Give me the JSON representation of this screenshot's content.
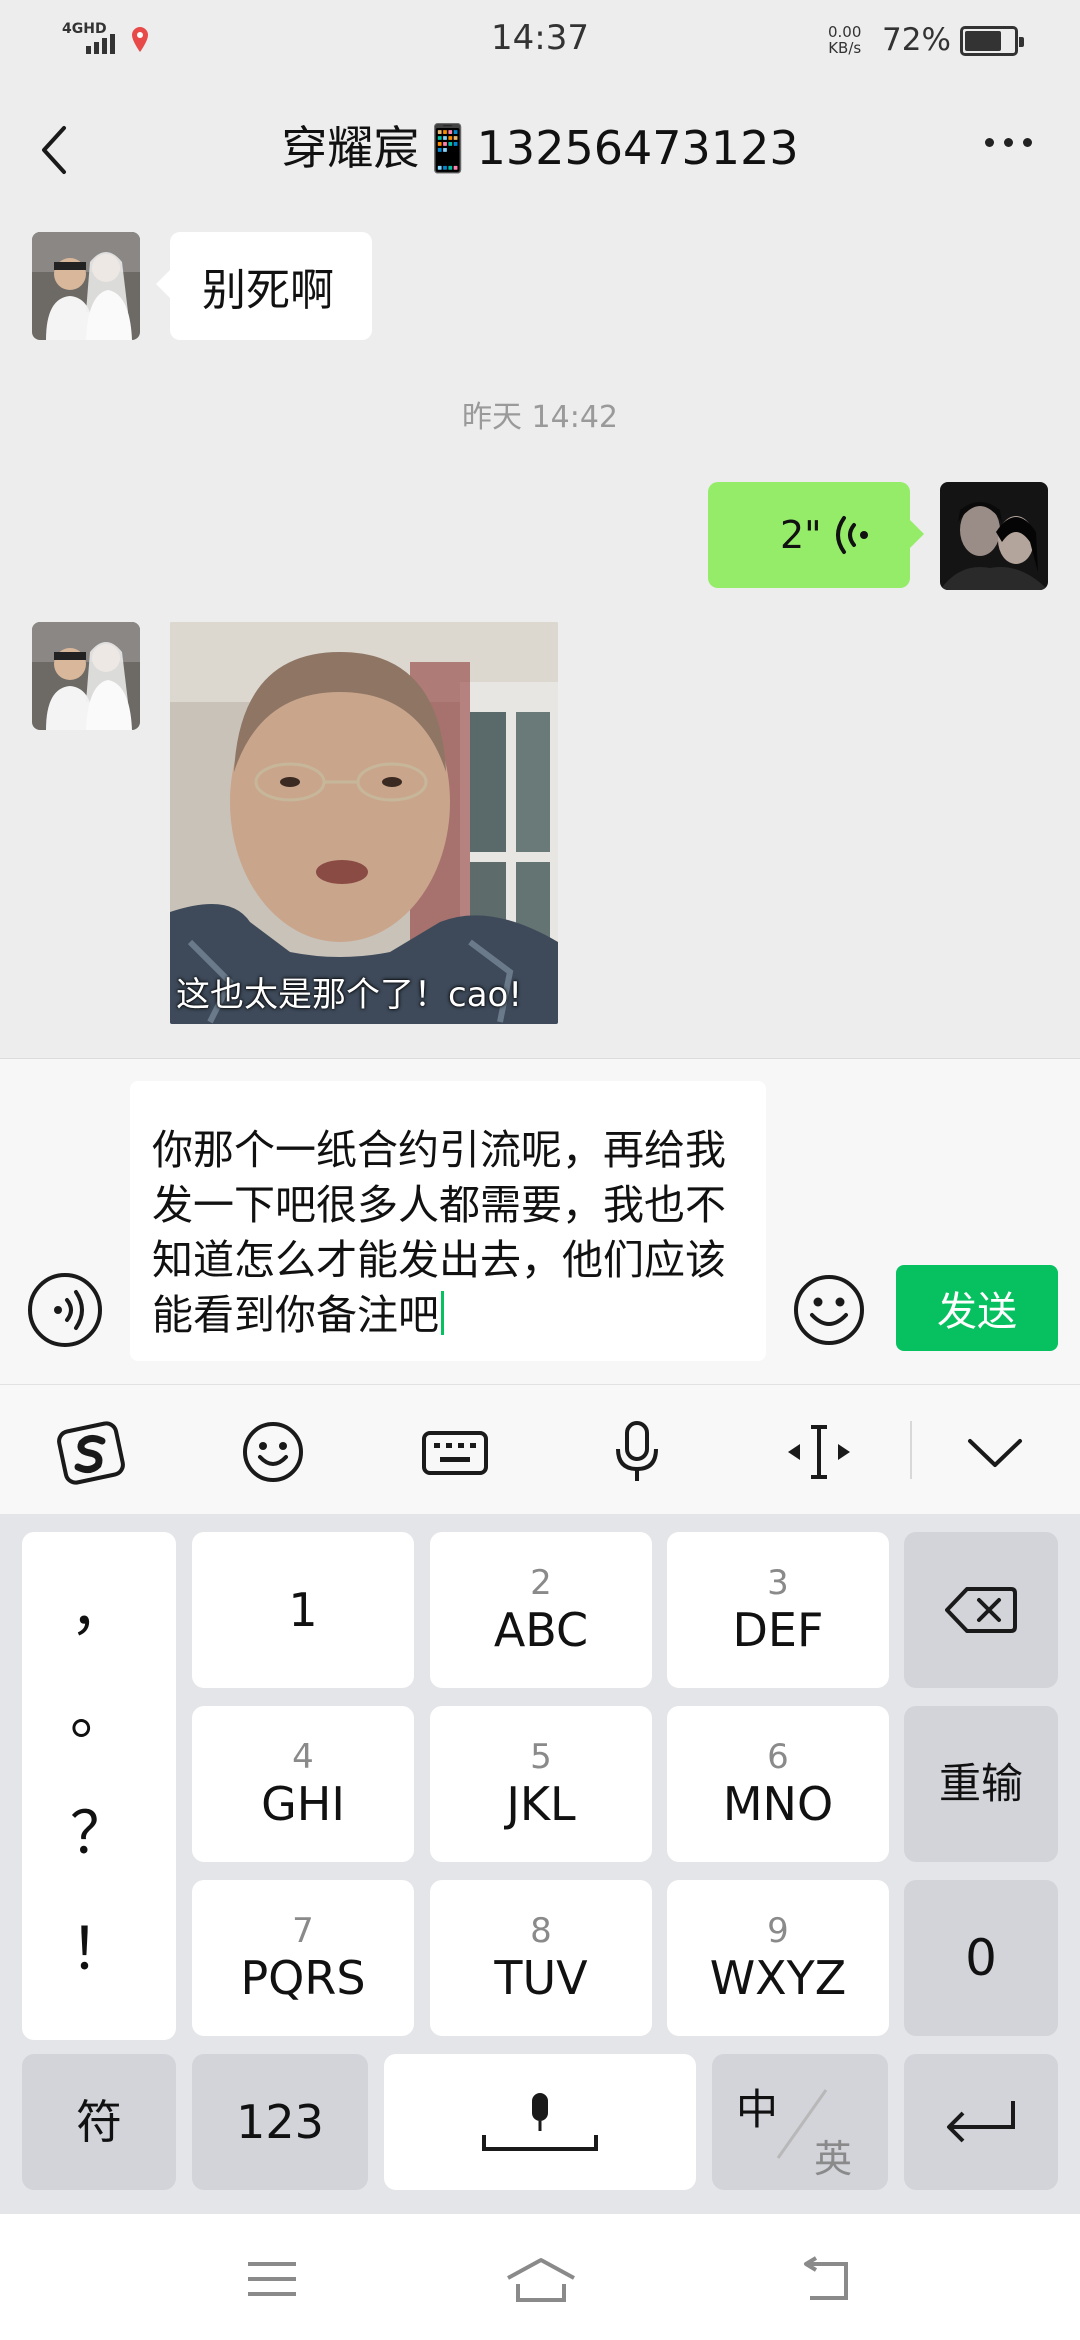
{
  "status_bar": {
    "network": "4GHD",
    "time": "14:37",
    "speed_value": "0.00",
    "speed_unit": "KB/s",
    "battery": "72%",
    "battery_level": 0.72
  },
  "header": {
    "title": "穿耀宸📱13256473123"
  },
  "messages": [
    {
      "side": "in",
      "type": "text",
      "text": "别死啊"
    },
    {
      "type": "timestamp",
      "text": "昨天 14:42"
    },
    {
      "side": "out",
      "type": "voice",
      "duration": "2\""
    },
    {
      "side": "in",
      "type": "image",
      "caption": "这也太是那个了！cao!"
    }
  ],
  "composer": {
    "text": "你那个一纸合约引流呢，再给我发一下吧很多人都需要，我也不知道怎么才能发出去，他们应该能看到你备注吧",
    "send_label": "发送"
  },
  "keyboard": {
    "toolbar_icons": [
      "sogou-logo-icon",
      "emoji-icon",
      "keyboard-icon",
      "microphone-icon",
      "cursor-move-icon",
      "collapse-chevron-icon"
    ],
    "punctuation": [
      "，",
      "。",
      "？",
      "！"
    ],
    "keys": [
      {
        "num": "",
        "label": "1"
      },
      {
        "num": "2",
        "label": "ABC"
      },
      {
        "num": "3",
        "label": "DEF"
      },
      {
        "num": "4",
        "label": "GHI"
      },
      {
        "num": "5",
        "label": "JKL"
      },
      {
        "num": "6",
        "label": "MNO"
      },
      {
        "num": "7",
        "label": "PQRS"
      },
      {
        "num": "8",
        "label": "TUV"
      },
      {
        "num": "9",
        "label": "WXYZ"
      }
    ],
    "retype": "重输",
    "zero": "0",
    "symbols": "符",
    "numbers": "123",
    "lang_cn": "中",
    "lang_en": "英"
  },
  "colors": {
    "accent_green": "#07c160",
    "bubble_out": "#95ec69",
    "background": "#ededed"
  }
}
